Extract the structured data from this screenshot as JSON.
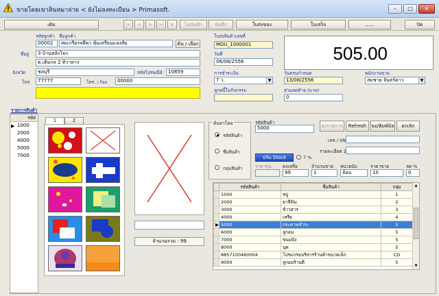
{
  "window": {
    "title": "ขายโดยเขาสินหมาจ่าย  < ยังไม่ลงทะเบียน > Primasoft.",
    "controls": [
      "–",
      "□",
      "×"
    ]
  },
  "toolbar": {
    "left_label": "เดิม",
    "disabled_labels": [
      "ไม่บันทึก",
      "บันทึก"
    ],
    "icon_chars": [
      "|<",
      "<",
      ">",
      ">|",
      "x"
    ],
    "right_labels": [
      "ใบส่งของ",
      "ใบเสร็จ",
      "......"
    ],
    "far_right_label": "ปิด"
  },
  "customer": {
    "code_label": "รหัสลูกค้า",
    "name_label": "ชื่อลูกค้า",
    "code": "00002",
    "name": "สมเกรียรจดีทา หุ้นเหรียนแลงสัม",
    "search_btn": "ค้น / เลือก",
    "address_label": "ที่อยู่",
    "address1": "3 บ้านหลังโจก",
    "address2": "ต.เติมกล 2 ทิวาหาร",
    "province_label": "จังหวัด",
    "province": "ชลบุรี",
    "zip_label": "รหัสไปรษณีย์",
    "zip": "10859",
    "phone_label": "โทร.",
    "phone": "77777",
    "fax_label": "โทร. / Fax",
    "fax": "00000"
  },
  "doc": {
    "docno_label": "ใบส่งสินค้าเลขที่",
    "docno": "MOU_1000001",
    "date_label": "วันที่",
    "date": "06/08/2556",
    "pay_label": "การชำระเงิน",
    "pay": "7 ว.",
    "due_label": "วันครบกำหนด",
    "due": "13/08/2556",
    "seller_label": "พนักงานขาย",
    "seller": "สมชาย จันทร์ดาว",
    "credit_label": "ลูกหนี้ในกิจกรรม",
    "credit": "",
    "discount_label": "ส่วนลดท้าย (บาท)",
    "discount": "0",
    "total": "505.00"
  },
  "items": {
    "section_label": "รายการสินค้า",
    "col_code": "รหัส",
    "codes": [
      "1000",
      "2000",
      "4000",
      "5000",
      "7000"
    ],
    "tabs": [
      "1",
      "2"
    ],
    "count_label": "จำนวนรวม : 99"
  },
  "search": {
    "group_label": "ค้นหาโดย",
    "options": [
      "รหัสสินค้า",
      "ชื่อสินค้า",
      "กลุ่มสินค้า"
    ],
    "code_label": "รหัสสินค้า",
    "code_value": "5000",
    "add_btn": "ลงรายการ",
    "refresh_btn": "Refresh",
    "print_btn": "จอ/พิมพ์บิล",
    "delete_btn": "ยกเลิก",
    "serial_label": "เลข / SN :",
    "detail_label": "รายละเอียด 2",
    "stock_btn": "ปรับ Stock",
    "vat_label": "7 %",
    "cost_label": "ราคาทุน",
    "qty_label": "คงเหลือ",
    "amount_label": "จำนวนขาย",
    "unit_label": "หน่วยนับ",
    "price_label": "ราคาขาย",
    "disc_label": "ลด %",
    "qty_value": "99",
    "amount_value": "1",
    "unit_value": "ล้อน",
    "price_value": "10",
    "disc_value": "0"
  },
  "grid": {
    "headers": [
      "รหัสสินค้า",
      "ชื่อสินค้า",
      "กลุ่ม"
    ],
    "rows": [
      [
        "1000",
        "สบู่",
        "1"
      ],
      [
        "2000",
        "ยาสีฟัน",
        "2"
      ],
      [
        "3000",
        "ข้าวสาร",
        "3"
      ],
      [
        "4000",
        "เหรีย",
        "4"
      ],
      [
        "5000",
        "กระดาษชำระ",
        "5"
      ],
      [
        "6000",
        "ลูกอม",
        "5"
      ],
      [
        "7000",
        "ขนมปัง",
        "5"
      ],
      [
        "8000",
        "นุด",
        "5"
      ],
      [
        "8857100460004",
        "โปรแกรมบริหารร้านค้าขนาดเล็ก",
        "CD"
      ],
      [
        "9000",
        "ลูกอมร้านดี",
        "5"
      ]
    ],
    "selected_index": 4
  },
  "palette": {
    "accent_yellow": "#ffff00",
    "title_blue": "#1b36a6",
    "grid_selected": "#3b7fd6"
  }
}
